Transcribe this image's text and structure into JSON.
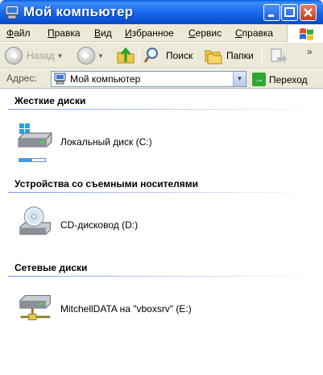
{
  "window": {
    "title": "Мой компьютер",
    "buttons": {
      "minimize": "_",
      "maximize": "□",
      "close": "X"
    }
  },
  "menu": [
    {
      "pre": "",
      "u": "Ф",
      "post": "айл"
    },
    {
      "pre": "",
      "u": "П",
      "post": "равка"
    },
    {
      "pre": "",
      "u": "В",
      "post": "ид"
    },
    {
      "pre": "",
      "u": "И",
      "post": "збранное"
    },
    {
      "pre": "",
      "u": "С",
      "post": "ервис"
    },
    {
      "pre": "",
      "u": "С",
      "post": "правка"
    }
  ],
  "toolbar": {
    "back": "Назад",
    "search": "Поиск",
    "folders": "Папки"
  },
  "address": {
    "label": "Адрес:",
    "value": "Мой компьютер",
    "go": "Переход"
  },
  "groups": {
    "hard_disks": {
      "title": "Жесткие диски",
      "items": [
        {
          "label": "Локальный диск (C:)",
          "usage_fraction": 0.5
        }
      ]
    },
    "removable": {
      "title": "Устройства со съемными носителями",
      "items": [
        {
          "label": "CD-дисковод (D:)"
        }
      ]
    },
    "network": {
      "title": "Сетевые диски",
      "items": [
        {
          "label": "MitchellDATA на \"vboxsrv\" (E:)"
        }
      ]
    }
  },
  "colors": {
    "titlebar": "#0b55d8",
    "menubar": "#ece9d8",
    "group_line": "#7a96df"
  }
}
